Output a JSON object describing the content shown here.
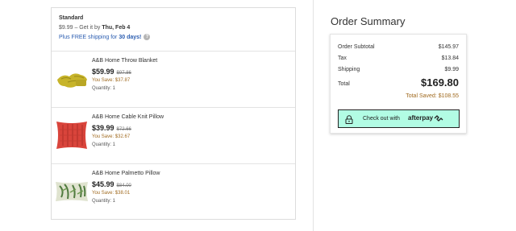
{
  "shipping": {
    "method": "Standard",
    "cost_line": "$9.99 – Get it by",
    "delivery_date": "Thu, Feb 4",
    "free_text": "Plus FREE shipping for",
    "free_days": "30 days!",
    "help_icon": "?"
  },
  "items": [
    {
      "name": "A&B Home Throw Blanket",
      "price": "$59.99",
      "old_price": "$97.86",
      "save": "You Save: $37.87",
      "qty": "Quantity: 1",
      "thumb_icon": "yellow-throw-blanket"
    },
    {
      "name": "A&B Home Cable Knit Pillow",
      "price": "$39.99",
      "old_price": "$72.66",
      "save": "You Save: $32.67",
      "qty": "Quantity: 1",
      "thumb_icon": "red-knit-pillow"
    },
    {
      "name": "A&B Home Palmetto Pillow",
      "price": "$45.99",
      "old_price": "$84.00",
      "save": "You Save: $38.01",
      "qty": "Quantity: 1",
      "thumb_icon": "palmetto-pillow"
    }
  ],
  "summary": {
    "title": "Order Summary",
    "subtotal_label": "Order Subtotal",
    "subtotal_value": "$145.97",
    "tax_label": "Tax",
    "tax_value": "$13.84",
    "shipping_label": "Shipping",
    "shipping_value": "$9.99",
    "total_label": "Total",
    "total_value": "$169.80",
    "total_saved": "Total Saved: $108.55"
  },
  "afterpay": {
    "label": "Check out with",
    "brand": "afterpay",
    "bg_color": "#b2fce4"
  },
  "colors": {
    "savings": "#a06a1f",
    "link": "#2a5cb0"
  }
}
